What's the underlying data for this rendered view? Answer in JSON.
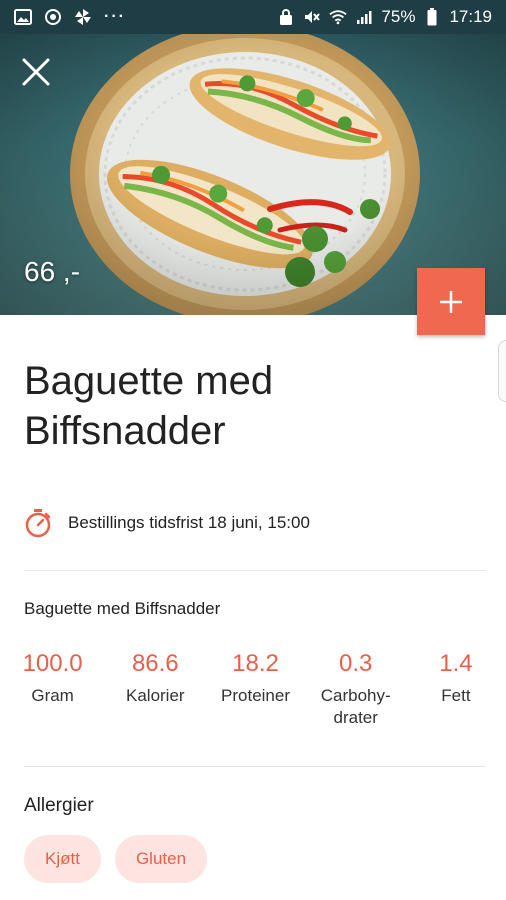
{
  "status_bar": {
    "battery": "75%",
    "time": "17:19",
    "dots": "···",
    "icons_left": [
      "image-icon",
      "sync-icon",
      "pinwheel-icon"
    ],
    "icons_right": [
      "lock-icon",
      "mute-icon",
      "wifi-icon",
      "signal-icon",
      "battery-icon"
    ]
  },
  "hero": {
    "price": "66 ,-",
    "image_subject": "baguette-photo"
  },
  "product": {
    "title": "Baguette med Biffsnadder",
    "deadline": "Bestillings tidsfrist 18 juni, 15:00"
  },
  "nutrition": {
    "heading": "Baguette med Biffsnadder",
    "items": [
      {
        "value": "100.0",
        "label": "Gram"
      },
      {
        "value": "86.6",
        "label": "Kalorier"
      },
      {
        "value": "18.2",
        "label": "Proteiner"
      },
      {
        "value": "0.3",
        "label": "Carbohy-\ndrater"
      },
      {
        "value": "1.4",
        "label": "Fett"
      }
    ]
  },
  "allergies": {
    "heading": "Allergier",
    "tags": [
      "Kjøtt",
      "Gluten"
    ]
  },
  "colors": {
    "accent": "#f0684f",
    "accent_text": "#e8604a",
    "chip_bg": "#fde4e1",
    "status_bar": "#1e3d44"
  }
}
